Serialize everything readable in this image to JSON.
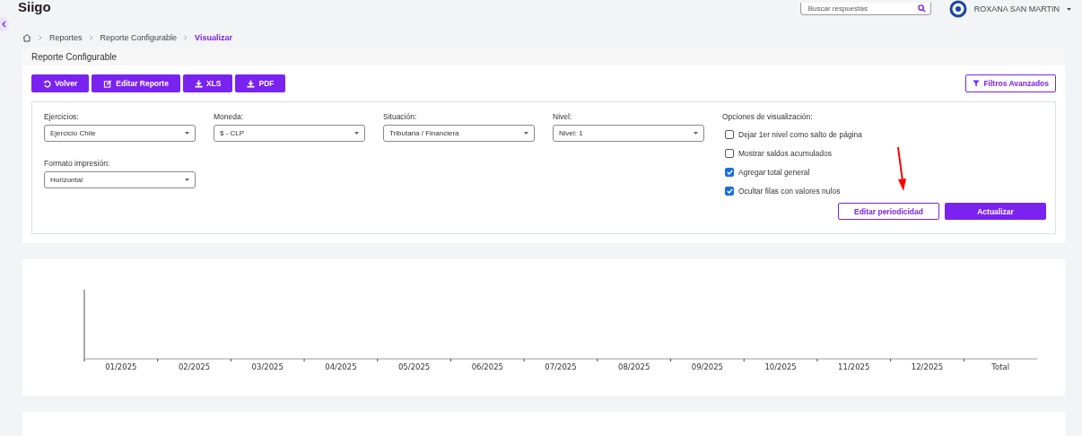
{
  "header": {
    "brand": "Siigo",
    "search": {
      "placeholder": "Buscar respuestas"
    },
    "user": "ROXANA SAN MARTIN"
  },
  "breadcrumb": [
    {
      "label": "Reportes",
      "current": false
    },
    {
      "label": "Reporte Configurable",
      "current": false
    },
    {
      "label": "Visualizar",
      "current": true
    }
  ],
  "card_title": "Reporte Configurable",
  "toolbar": [
    {
      "label": "Volver",
      "kind": "back"
    },
    {
      "label": "Editar Reporte",
      "kind": "edit"
    },
    {
      "label": "XLS",
      "kind": "download"
    },
    {
      "label": "PDF",
      "kind": "download"
    }
  ],
  "advanced_filters": "Filtros Avanzados",
  "filters": [
    {
      "label": "Ejercicios:",
      "value": "Ejercicio Chile"
    },
    {
      "label": "Moneda:",
      "value": "$ - CLP"
    },
    {
      "label": "Situación:",
      "value": "Tributaria / Financiera"
    },
    {
      "label": "Nivel:",
      "value": "Nivel: 1"
    },
    {
      "label": "Formato impresión:",
      "value": "Horizontal"
    }
  ],
  "options": {
    "title": "Opciones de visualización:",
    "items": [
      {
        "label": "Dejar 1er nivel como salto de página",
        "checked": false
      },
      {
        "label": "Mostrar saldos acumulados",
        "checked": false
      },
      {
        "label": "Agregar total general",
        "checked": true
      },
      {
        "label": "Ocultar filas con valores nulos",
        "checked": true
      }
    ]
  },
  "actions": [
    {
      "label": "Editar periodicidad",
      "kind": "outline"
    },
    {
      "label": "Actualizar",
      "kind": "primary"
    }
  ],
  "annotation": {
    "kind": "arrow",
    "color": "#ff0000"
  },
  "chart": {
    "x_labels": [
      "01/2025",
      "02/2025",
      "03/2025",
      "04/2025",
      "05/2025",
      "06/2025",
      "07/2025",
      "08/2025",
      "09/2025",
      "10/2025",
      "11/2025",
      "12/2025",
      "Total"
    ]
  }
}
